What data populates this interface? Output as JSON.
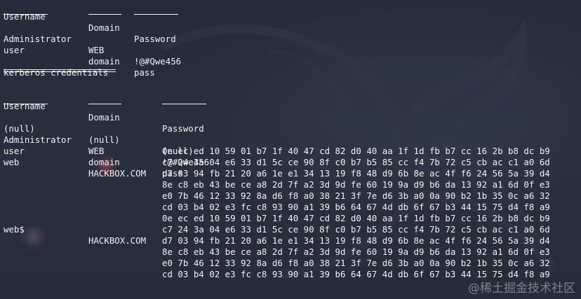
{
  "top_table": {
    "headers": [
      "Username",
      "Domain",
      "Password"
    ],
    "rows": [
      [
        "Administrator",
        "WEB",
        "!@#Qwe456"
      ],
      [
        "user",
        "domain",
        "pass"
      ]
    ]
  },
  "kerberos": {
    "title": "kerberos credentials",
    "headers": [
      "Username",
      "Domain",
      "Password"
    ],
    "rows": [
      [
        "(null)",
        "(null)",
        "(null)"
      ],
      [
        "Administrator",
        "WEB",
        "!@#Qwe456"
      ],
      [
        "user",
        "domain",
        "pass"
      ]
    ],
    "entries": [
      {
        "username": "web",
        "domain": "HACKBOX.COM",
        "password_lines": [
          "0e ec ed 10 59 01 b7 1f 40 47 cd 82 d0 40 aa 1f 1d fb b7 cc 16 2b b8 dc b9",
          "c7 24 3a 04 e6 33 d1 5c ce 90 8f c0 b7 b5 85 cc f4 7b 72 c5 cb ac c1 a0 6d",
          "d7 03 94 fb 21 20 a6 1e e1 34 13 19 f8 48 d9 6b 8e ac 4f f6 24 56 5a 39 d4",
          "8e c8 eb 43 be ce a8 2d 7f a2 3d 9d fe 60 19 9a d9 b6 da 13 92 a1 6d 0f e3",
          "e0 7b 46 12 33 92 8a d6 f8 a0 38 21 3f 7e d6 3b a0 0a 90 b2 1b 35 0c a6 32",
          "cd 03 b4 02 e3 fc c8 93 90 a1 39 b6 64 67 4d db 6f 67 b3 44 15 75 d4 f8 a9"
        ]
      },
      {
        "username": "web$",
        "domain": "HACKBOX.COM",
        "password_lines": [
          "0e ec ed 10 59 01 b7 1f 40 47 cd 82 d0 40 aa 1f 1d fb b7 cc 16 2b b8 dc b9",
          "c7 24 3a 04 e6 33 d1 5c ce 90 8f c0 b7 b5 85 cc f4 7b 72 c5 cb ac c1 a0 6d",
          "d7 03 94 fb 21 20 a6 1e e1 34 13 19 f8 48 d9 6b 8e ac 4f f6 24 56 5a 39 d4",
          "8e c8 eb 43 be ce a8 2d 7f a2 3d 9d fe 60 19 9a d9 b6 da 13 92 a1 6d 0f e3",
          "e0 7b 46 12 33 92 8a d6 f8 a0 38 21 3f 7e d6 3b a0 0a 90 b2 1b 35 0c a6 32",
          "cd 03 b4 02 e3 fc c8 93 90 a1 39 b6 64 67 4d db 6f 67 b3 44 15 75 d4 f8 a9"
        ]
      }
    ]
  },
  "watermark": "@稀土掘金技术社区",
  "colors": {
    "background": "#272d3a",
    "text": "#eef1f6",
    "dragon": "#303746"
  }
}
